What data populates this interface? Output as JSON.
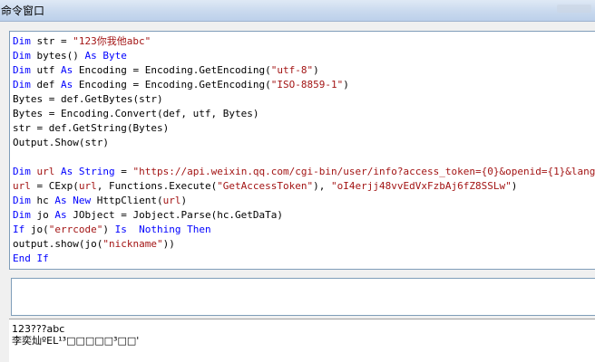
{
  "window": {
    "title": "命令窗口"
  },
  "code": [
    [
      {
        "t": "Dim ",
        "c": "kw"
      },
      {
        "t": "str = "
      },
      {
        "t": "\"123你我他abc\"",
        "c": "str"
      }
    ],
    [
      {
        "t": "Dim ",
        "c": "kw"
      },
      {
        "t": "bytes() "
      },
      {
        "t": "As Byte",
        "c": "kw"
      }
    ],
    [
      {
        "t": "Dim ",
        "c": "kw"
      },
      {
        "t": "utf "
      },
      {
        "t": "As ",
        "c": "kw"
      },
      {
        "t": "Encoding = Encoding.GetEncoding("
      },
      {
        "t": "\"utf-8\"",
        "c": "str"
      },
      {
        "t": ")"
      }
    ],
    [
      {
        "t": "Dim ",
        "c": "kw"
      },
      {
        "t": "def "
      },
      {
        "t": "As ",
        "c": "kw"
      },
      {
        "t": "Encoding = Encoding.GetEncoding("
      },
      {
        "t": "\"ISO-8859-1\"",
        "c": "str"
      },
      {
        "t": ")"
      }
    ],
    [
      {
        "t": "Bytes = def.GetBytes(str)"
      }
    ],
    [
      {
        "t": "Bytes = Encoding.Convert(def, utf, Bytes)"
      }
    ],
    [
      {
        "t": "str = def.GetString(Bytes)"
      }
    ],
    [
      {
        "t": "Output.Show(str)"
      }
    ],
    [
      {
        "t": ""
      }
    ],
    [
      {
        "t": "Dim ",
        "c": "kw"
      },
      {
        "t": "url",
        "c": "var"
      },
      {
        "t": " "
      },
      {
        "t": "As String",
        "c": "kw"
      },
      {
        "t": " = "
      },
      {
        "t": "\"https://api.weixin.qq.com/cgi-bin/user/info?access_token={0}&openid={1}&lang=zh_CN\"",
        "c": "str"
      }
    ],
    [
      {
        "t": "url",
        "c": "var"
      },
      {
        "t": " = CExp("
      },
      {
        "t": "url",
        "c": "var"
      },
      {
        "t": ", Functions.Execute("
      },
      {
        "t": "\"GetAccessToken\"",
        "c": "str"
      },
      {
        "t": "), "
      },
      {
        "t": "\"oI4erjj48vvEdVxFzbAj6fZ8SSLw\"",
        "c": "str"
      },
      {
        "t": ")"
      }
    ],
    [
      {
        "t": "Dim ",
        "c": "kw"
      },
      {
        "t": "hc "
      },
      {
        "t": "As New ",
        "c": "kw"
      },
      {
        "t": "HttpClient("
      },
      {
        "t": "url",
        "c": "var"
      },
      {
        "t": ")"
      }
    ],
    [
      {
        "t": "Dim ",
        "c": "kw"
      },
      {
        "t": "jo "
      },
      {
        "t": "As ",
        "c": "kw"
      },
      {
        "t": "JObject = Jobject.Parse(hc.GetDaTa)"
      }
    ],
    [
      {
        "t": "If ",
        "c": "kw"
      },
      {
        "t": "jo("
      },
      {
        "t": "\"errcode\"",
        "c": "str"
      },
      {
        "t": ") "
      },
      {
        "t": "Is  Nothing Then",
        "c": "kw"
      }
    ],
    [
      {
        "t": "output.show(jo("
      },
      {
        "t": "\"nickname\"",
        "c": "str"
      },
      {
        "t": "))"
      }
    ],
    [
      {
        "t": "End If",
        "c": "kw"
      }
    ]
  ],
  "output": {
    "line1": "123???abc",
    "line2": "李奕灿ºEL¹³□□□□□³□□'"
  }
}
